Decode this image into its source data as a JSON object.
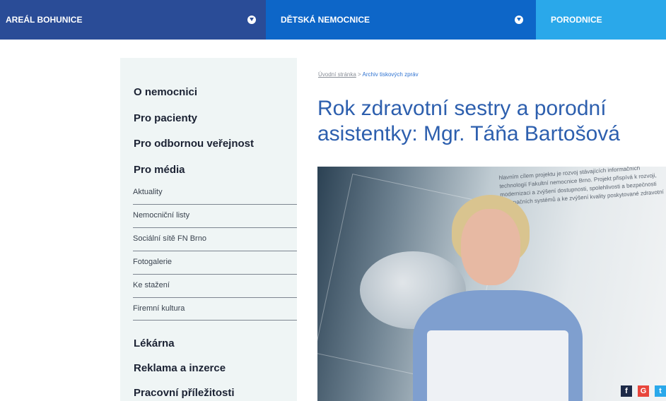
{
  "topnav": {
    "tabs": [
      {
        "label": "AREÁL BOHUNICE"
      },
      {
        "label": "DĚTSKÁ NEMOCNICE"
      },
      {
        "label": "PORODNICE"
      }
    ]
  },
  "sidebar": {
    "main_items": [
      "O nemocnici",
      "Pro pacienty",
      "Pro odbornou veřejnost",
      "Pro média"
    ],
    "sub_items": [
      "Aktuality",
      "Nemocniční listy",
      "Sociální sítě FN Brno",
      "Fotogalerie",
      "Ke stažení",
      "Firemní kultura"
    ],
    "bottom_items": [
      "Lékárna",
      "Reklama a inzerce",
      "Pracovní příležitosti"
    ]
  },
  "breadcrumb": {
    "home": "Úvodní stránka",
    "separator": " > ",
    "current": "Archiv tiskových zpráv"
  },
  "article": {
    "title": "Rok zdravotní sestry a porodní asistentky: Mgr. Táňa Bartošová"
  },
  "photo": {
    "wall_text": "hlavním cílem projektu je rozvoj stávajících informačních technologií Fakultní nemocnice Brno. Projekt přispívá k rozvoji, modernizaci a zvýšení dostupnosti, spolehlivosti a bezpečnosti informačních systémů a ke zvýšení kvality poskytované zdravotní péče."
  },
  "share": {
    "facebook": "f",
    "google": "G",
    "twitter": "t"
  },
  "colors": {
    "nav_bohunice": "#2a4c97",
    "nav_detska": "#0d66c8",
    "nav_porodnice": "#2aa8ea",
    "title": "#2d5fae",
    "sidebar_bg": "#eff5f5"
  }
}
